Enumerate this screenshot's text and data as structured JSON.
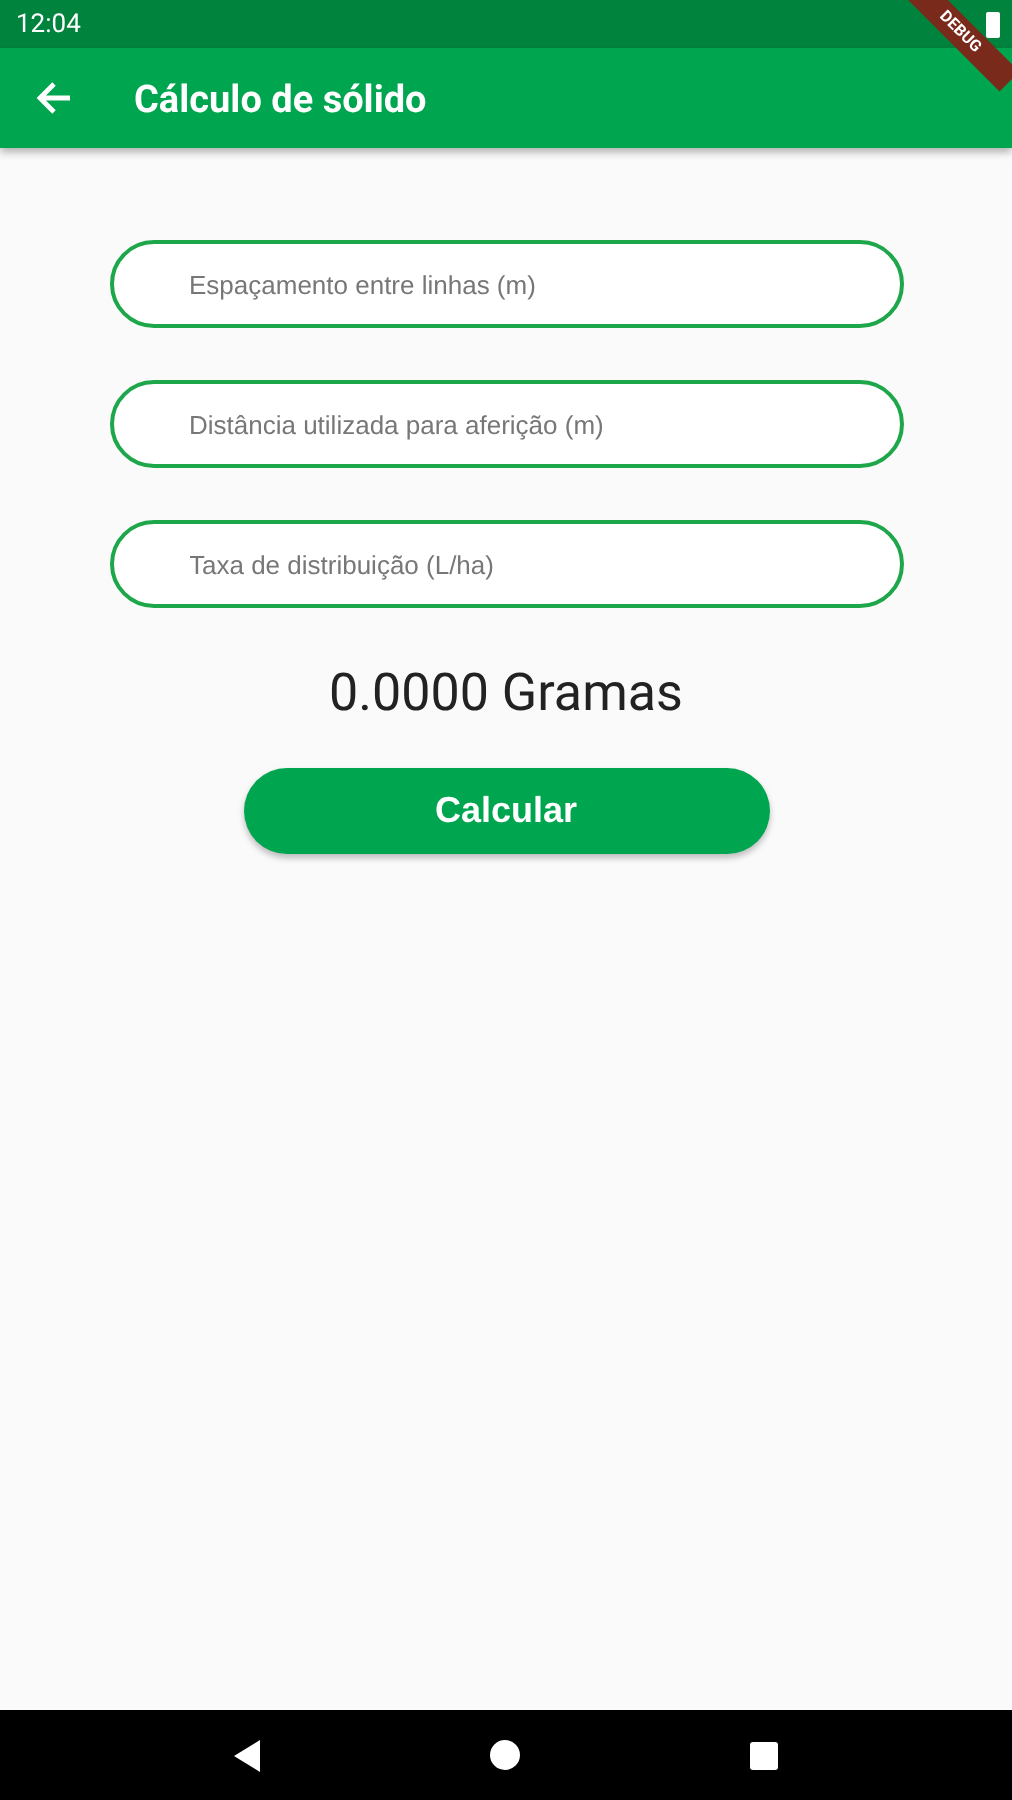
{
  "status_bar": {
    "time": "12:04"
  },
  "debug_banner": {
    "label": "DEBUG"
  },
  "app_bar": {
    "title": "Cálculo de sólido"
  },
  "fields": [
    {
      "placeholder": "Espaçamento entre linhas (m)"
    },
    {
      "placeholder": "Distância utilizada para aferição (m)"
    },
    {
      "placeholder": "Taxa de distribuição (L/ha)"
    }
  ],
  "result": "0.0000 Gramas",
  "button": {
    "label": "Calcular"
  }
}
